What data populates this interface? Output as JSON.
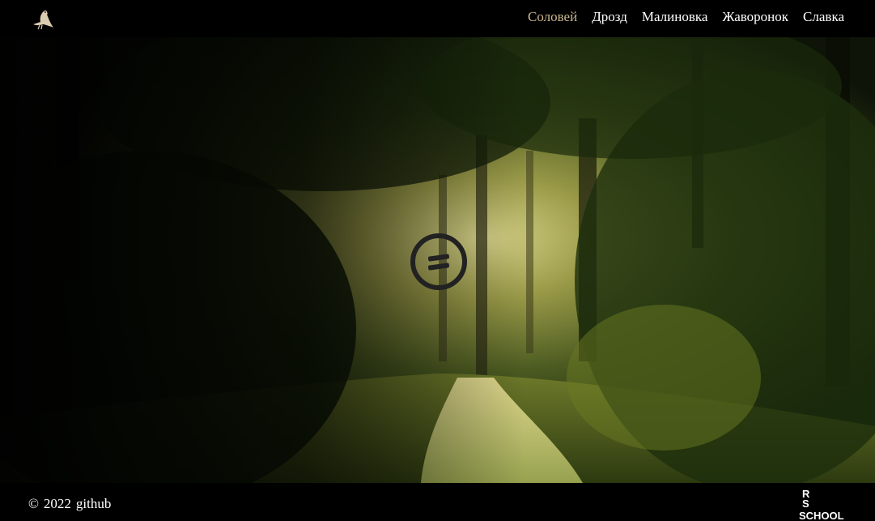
{
  "header": {
    "logo_icon": "bird-icon",
    "nav": [
      {
        "label": "Соловей",
        "active": true
      },
      {
        "label": "Дрозд",
        "active": false
      },
      {
        "label": "Малиновка",
        "active": false
      },
      {
        "label": "Жаворонок",
        "active": false
      },
      {
        "label": "Славка",
        "active": false
      }
    ],
    "active_color": "#c9b58d"
  },
  "hero": {
    "background": "forest-path-sunlight",
    "play_icon": "pause-icon"
  },
  "footer": {
    "copyright_symbol": "©",
    "year": "2022",
    "link": "github",
    "school_logo_line1": "R S",
    "school_logo_line2": "SCHOOL"
  }
}
